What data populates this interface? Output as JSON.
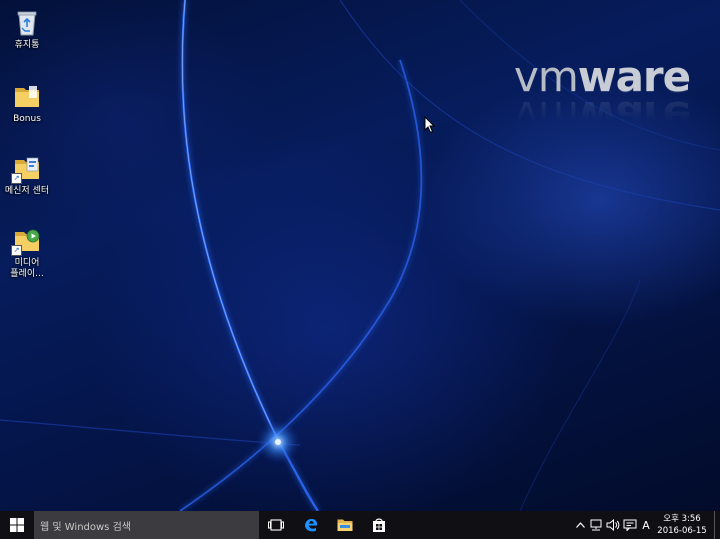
{
  "desktop": {
    "icons": [
      {
        "name": "recycle-bin",
        "label": "휴지통"
      },
      {
        "name": "bonus-folder",
        "label": "Bonus"
      },
      {
        "name": "messenger-center",
        "label": "메신저 센터"
      },
      {
        "name": "media-player",
        "label": "미디어\n플레이..."
      }
    ],
    "logo": {
      "text_light": "vm",
      "text_bold": "ware"
    }
  },
  "taskbar": {
    "search_placeholder": "웹 및 Windows 검색",
    "pinned": [
      "task-view-icon",
      "edge-icon",
      "file-explorer-icon",
      "store-icon"
    ],
    "tray": {
      "input_indicator": "A",
      "time": "오후 3:56",
      "date": "2016-06-15"
    }
  },
  "colors": {
    "taskbar_bg": "#101014",
    "search_bg": "#3b3b40",
    "accent_blue": "#1e90ff"
  }
}
